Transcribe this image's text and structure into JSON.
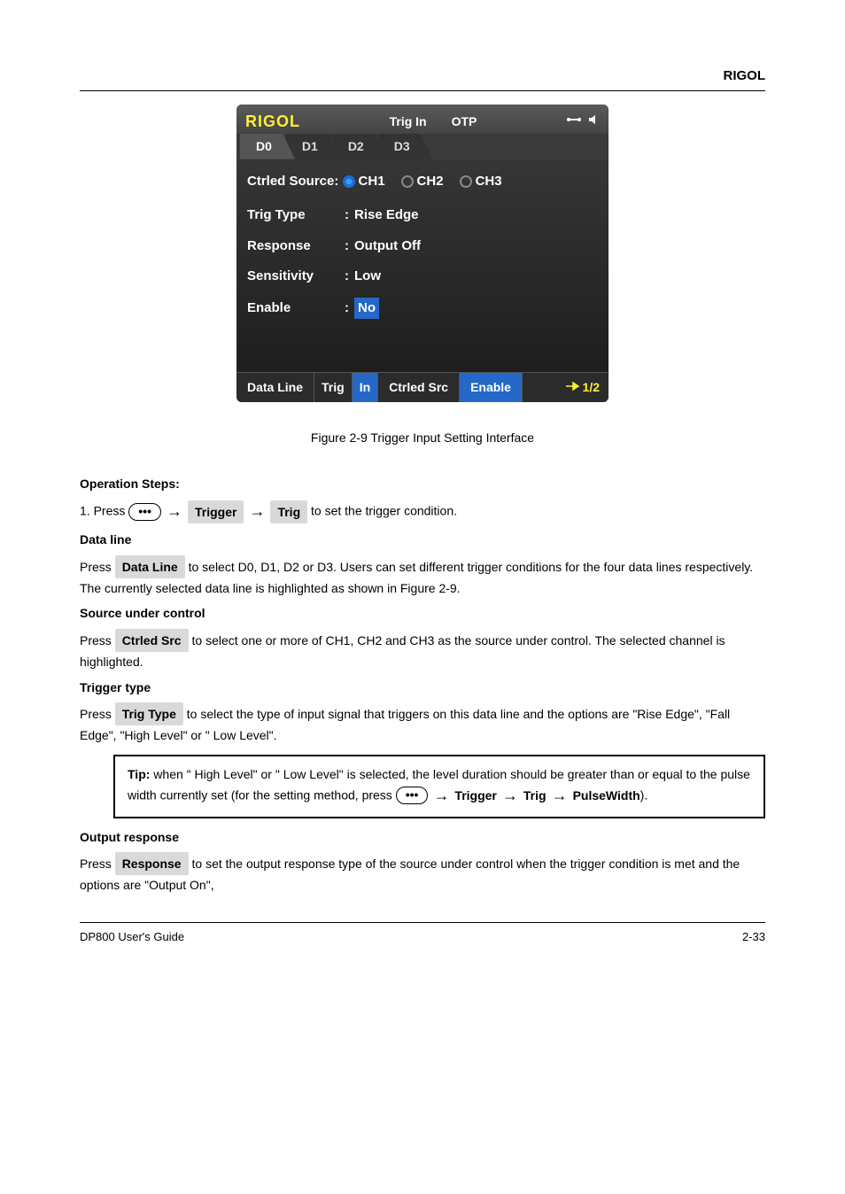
{
  "header": {
    "brand": "RIGOL"
  },
  "device": {
    "logo": "RIGOL",
    "status": {
      "trig": "Trig In",
      "otp": "OTP"
    },
    "tabs": [
      "D0",
      "D1",
      "D2",
      "D3"
    ],
    "active_tab": 0,
    "source_label": "Ctrled Source:",
    "sources": [
      "CH1",
      "CH2",
      "CH3"
    ],
    "selected_source": 0,
    "params": {
      "trig_type": {
        "label": "Trig Type",
        "value": "Rise Edge"
      },
      "response": {
        "label": "Response",
        "value": "Output Off"
      },
      "sensitivity": {
        "label": "Sensitivity",
        "value": "Low"
      },
      "enable": {
        "label": "Enable",
        "value": "No"
      }
    },
    "bottom": {
      "data_line": "Data Line",
      "trig": "Trig",
      "in": "In",
      "ctrled_src": "Ctrled Src",
      "enable": "Enable",
      "page": "1/2"
    }
  },
  "figure_caption": "Figure 2-9 Trigger Input Setting Interface",
  "operation_heading": "Operation Steps:",
  "nav": {
    "key": "•••",
    "btn1": "Trigger",
    "btn2": "Trig"
  },
  "step1": {
    "num": "1.",
    "pre": "Press",
    "after_nav": "to set the trigger condition.",
    "data_line_label": "Data line",
    "data_line_text_pre": "Press",
    "data_line_key": "Data Line",
    "data_line_text": "to select D0, D1, D2 or D3. Users can set different trigger conditions for the four data lines respectively. The currently selected data line is highlighted as shown in Figure 2-9.",
    "ctrled_label": "Source under control",
    "ctrled_text_pre": "Press",
    "ctrled_key": "Ctrled Src",
    "ctrled_text": "to select one or more of CH1, CH2 and CH3 as the source under control. The selected channel is highlighted.",
    "trig_label": "Trigger type",
    "trig_text_pre": "Press",
    "trig_key": "Trig Type",
    "trig_text": "to select the type of input signal that triggers on this data line and the options are \"Rise Edge\", \"Fall Edge\", \"High Level\" or \" Low Level\".",
    "tip_prefix": "Tip:",
    "tip_text": "when \" High Level\" or \" Low Level\" is selected, the level duration should be greater than or equal to the pulse width currently set (for the setting method, press ",
    "tip_key_ellipsis": "•••",
    "tip_key1": "Trigger",
    "tip_key2": "Trig",
    "tip_key3": "PulseWidth",
    "tip_tail": ").",
    "resp_label": "Output response",
    "resp_text_pre": "Press",
    "resp_key": "Response",
    "resp_text": "to set the output response type of the source under control when the trigger condition is met and the options are \"Output On\","
  },
  "footer": {
    "left": "DP800 User's Guide",
    "right": "2-33"
  }
}
